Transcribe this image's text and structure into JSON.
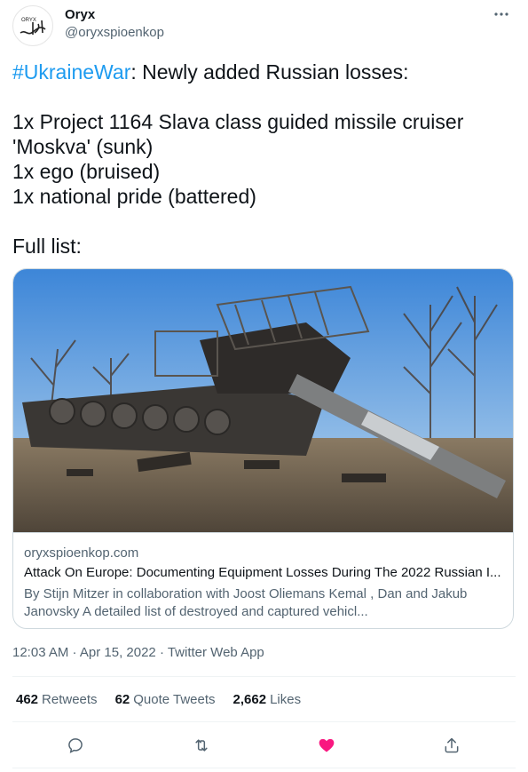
{
  "author": {
    "name": "Oryx",
    "handle": "@oryxspioenkop",
    "avatar_text": "ORYX"
  },
  "tweet": {
    "hashtag": "#UkraineWar",
    "lead": ": Newly added Russian losses:",
    "body": "1x Project 1164 Slava class guided missile cruiser\n'Moskva' (sunk)\n1x ego (bruised)\n1x national pride (battered)",
    "footer": "Full list:"
  },
  "card": {
    "domain": "oryxspioenkop.com",
    "title": "Attack On Europe: Documenting Equipment Losses During The 2022 Russian I...",
    "description": "By Stijn Mitzer in collaboration with Joost Oliemans Kemal , Dan and Jakub Janovsky     A detailed list of destroyed and captured vehicl...",
    "image_alt": "destroyed tank photo"
  },
  "meta": {
    "time": "12:03 AM",
    "date": "Apr 15, 2022",
    "client": "Twitter Web App",
    "line": "12:03 AM · Apr 15, 2022 · Twitter Web App"
  },
  "stats": {
    "retweets_count": "462",
    "retweets_label": "Retweets",
    "quotes_count": "62",
    "quotes_label": "Quote Tweets",
    "likes_count": "2,662",
    "likes_label": "Likes"
  },
  "actions": [
    "reply-icon",
    "retweet-icon",
    "like-icon",
    "share-icon"
  ],
  "colors": {
    "link": "#1d9bf0",
    "like_active": "#f91880",
    "secondary_text": "#536471"
  }
}
